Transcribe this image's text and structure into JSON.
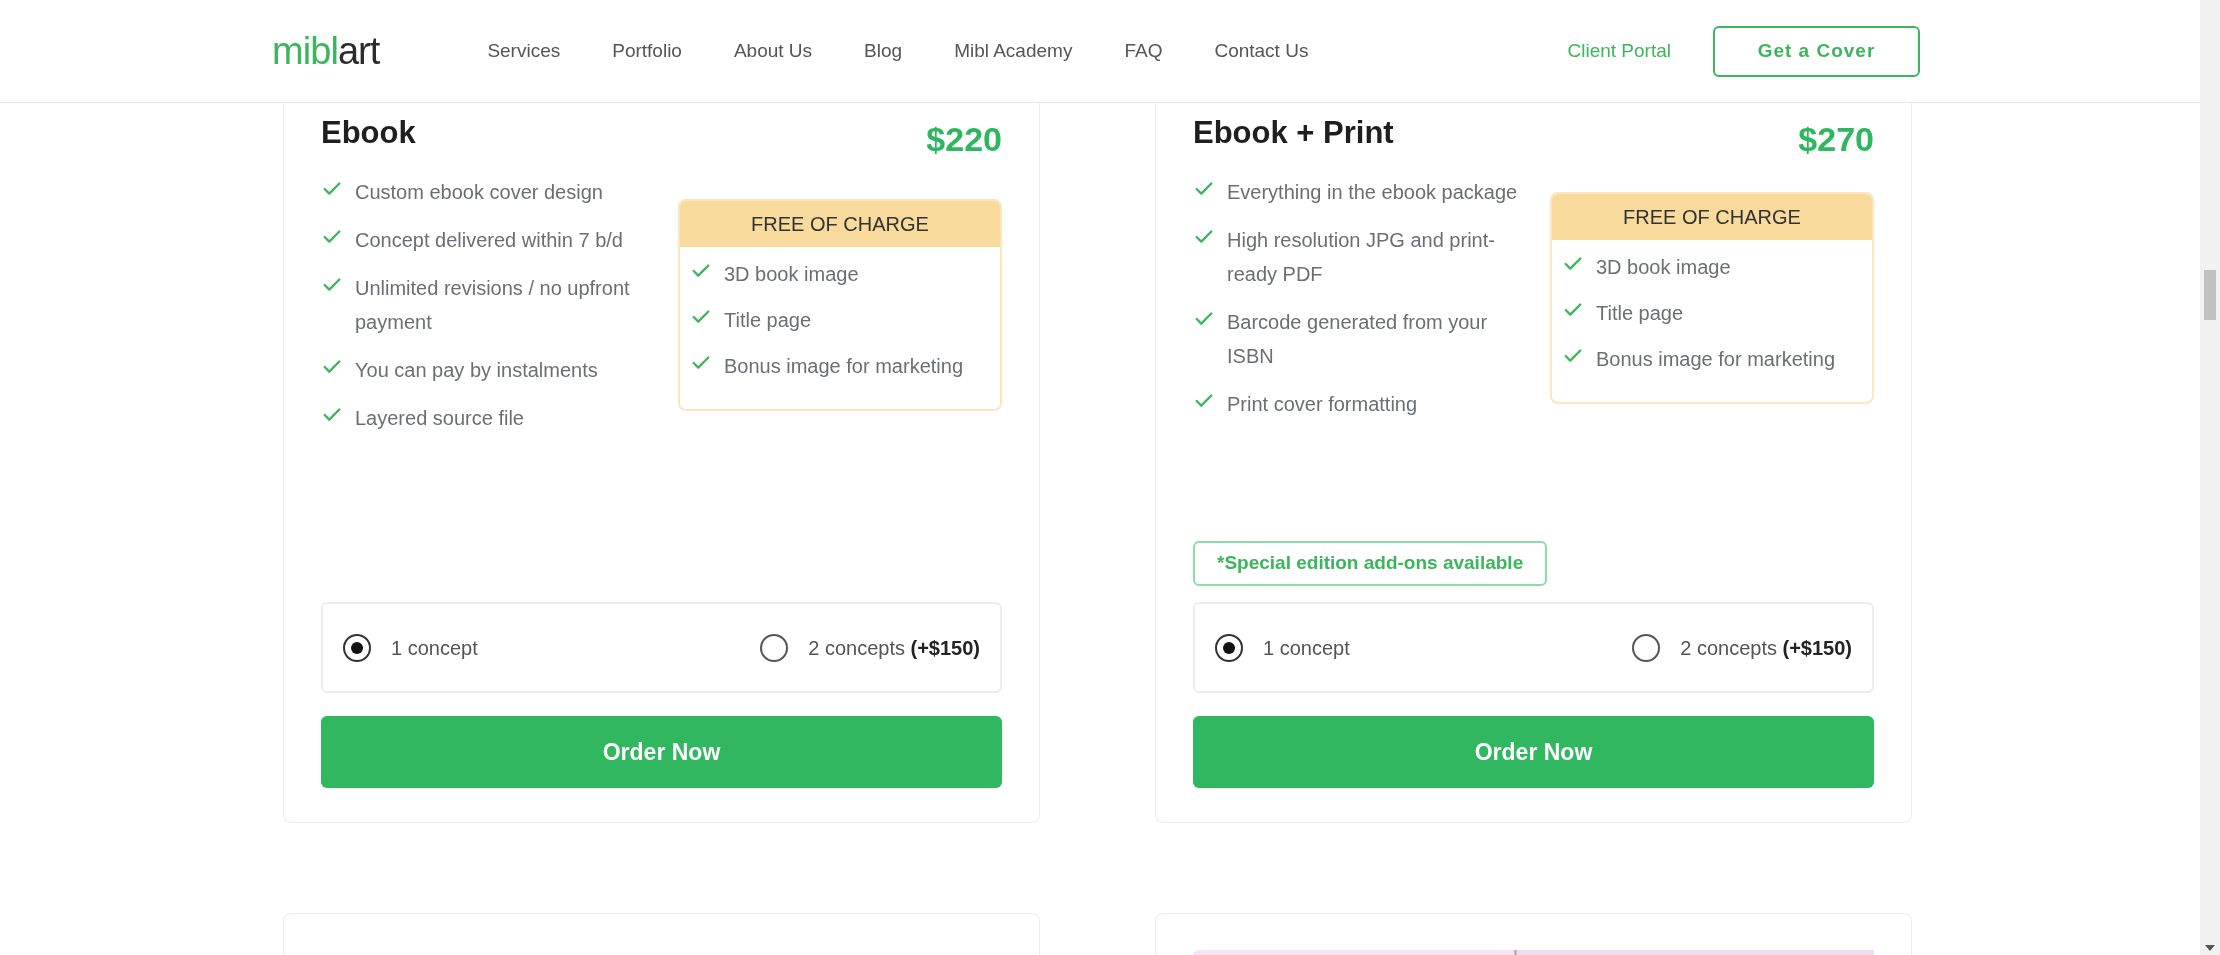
{
  "header": {
    "logo": {
      "part_1": "mibl",
      "part_2": "art"
    },
    "nav": [
      "Services",
      "Portfolio",
      "About Us",
      "Blog",
      "Mibl Academy",
      "FAQ",
      "Contact Us"
    ],
    "client_portal": "Client Portal",
    "cta": "Get a Cover"
  },
  "plans": [
    {
      "name": "Ebook",
      "price": "$220",
      "features": [
        "Custom ebook cover design",
        "Concept delivered within 7 b/d",
        "Unlimited revisions / no upfront payment",
        "You can pay by instalments",
        "Layered source file"
      ],
      "free_box": {
        "title": "FREE OF CHARGE",
        "items": [
          "3D book image",
          "Title page",
          "Bonus image for marketing"
        ]
      },
      "options": [
        {
          "label": "1 concept",
          "selected": true
        },
        {
          "label": "2 concepts **(+$150)**",
          "selected": false
        }
      ],
      "button": "Order Now"
    },
    {
      "name": "Ebook + Print",
      "price": "$270",
      "features": [
        "Everything in the ebook package",
        "High resolution JPG and print-ready PDF",
        "Barcode generated from your ISBN",
        "Print cover formatting"
      ],
      "free_box": {
        "title": "FREE OF CHARGE",
        "items": [
          "3D book image",
          "Title page",
          "Bonus image for marketing"
        ]
      },
      "note": "*Special edition add-ons available",
      "options": [
        {
          "label": "1 concept",
          "selected": true
        },
        {
          "label": "2 concepts **(+$150)**",
          "selected": false
        }
      ],
      "button": "Order Now"
    }
  ],
  "next_cards": [
    {
      "kind": "empty"
    },
    {
      "kind": "picture"
    }
  ]
}
